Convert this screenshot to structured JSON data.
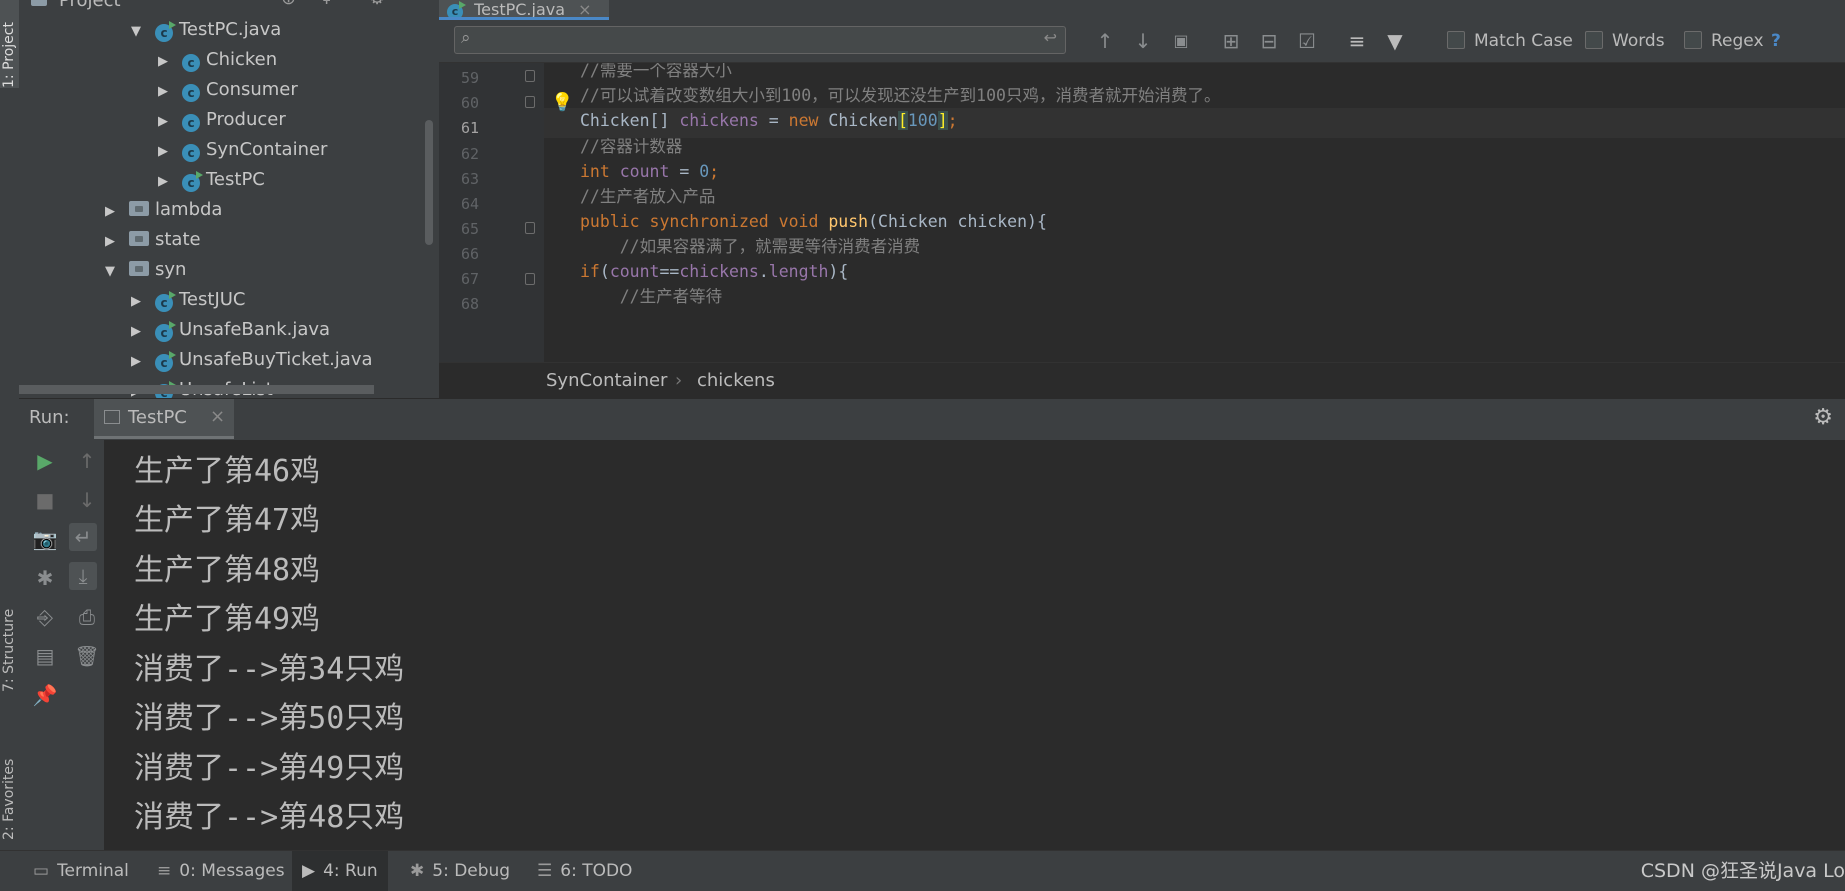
{
  "left_strip": {
    "project_tab": "1: Project",
    "structure_tab": "7: Structure",
    "favorites_tab": "2: Favorites"
  },
  "project_panel": {
    "title": "Project",
    "tree": [
      {
        "label": "TestPC.java",
        "icon": "run-class-icon",
        "expanded": true
      },
      {
        "label": "Chicken",
        "icon": "class-icon",
        "expanded": false
      },
      {
        "label": "Consumer",
        "icon": "class-icon",
        "expanded": false
      },
      {
        "label": "Producer",
        "icon": "class-icon",
        "expanded": false
      },
      {
        "label": "SynContainer",
        "icon": "class-icon",
        "expanded": false
      },
      {
        "label": "TestPC",
        "icon": "run-class-icon",
        "expanded": false
      },
      {
        "label": "lambda",
        "icon": "package-icon",
        "expanded": false
      },
      {
        "label": "state",
        "icon": "package-icon",
        "expanded": false
      },
      {
        "label": "syn",
        "icon": "package-icon",
        "expanded": true
      },
      {
        "label": "TestJUC",
        "icon": "run-class-icon",
        "expanded": false
      },
      {
        "label": "UnsafeBank.java",
        "icon": "run-class-icon",
        "expanded": false
      },
      {
        "label": "UnsafeBuyTicket.java",
        "icon": "run-class-icon",
        "expanded": false
      },
      {
        "label": "UnsafeList",
        "icon": "run-class-icon",
        "expanded": false
      }
    ]
  },
  "editor": {
    "tab_label": "TestPC.java",
    "search": {
      "value": "",
      "match_case": "Match Case",
      "words": "Words",
      "regex": "Regex",
      "help": "?"
    },
    "lines": [
      {
        "num": "59",
        "text": "//需要一个容器大小"
      },
      {
        "num": "60",
        "text": "//可以试着改变数组大小到100，可以发现还没生产到100只鸡，消费者就开始消费了。"
      },
      {
        "num": "61",
        "text": "Chicken[] chickens = new Chicken[100];"
      },
      {
        "num": "62",
        "text": "//容器计数器"
      },
      {
        "num": "63",
        "text": "int count = 0;"
      },
      {
        "num": "64",
        "text": "//生产者放入产品"
      },
      {
        "num": "65",
        "text": "public synchronized void push(Chicken chicken){"
      },
      {
        "num": "66",
        "text": "    //如果容器满了，就需要等待消费者消费"
      },
      {
        "num": "67",
        "text": "if(count==chickens.length){"
      },
      {
        "num": "68",
        "text": "    //生产者等待"
      }
    ],
    "current_line": "61",
    "breadcrumb": [
      "SynContainer",
      "chickens"
    ]
  },
  "run_panel": {
    "label": "Run:",
    "tab": "TestPC",
    "output": [
      "生产了第46鸡",
      "生产了第47鸡",
      "生产了第48鸡",
      "生产了第49鸡",
      "消费了-->第34只鸡",
      "消费了-->第50只鸡",
      "消费了-->第49只鸡",
      "消费了-->第48只鸡"
    ]
  },
  "bottom_bar": {
    "terminal": "Terminal",
    "messages": "0: Messages",
    "run": "4: Run",
    "debug": "5: Debug",
    "todo": "6: TODO",
    "watermark": "CSDN @狂圣说Java Lo"
  },
  "colors": {
    "background": "#2b2b2b",
    "panel": "#3c3f41",
    "keyword": "#cc7832",
    "comment": "#808080",
    "field": "#9876aa",
    "number": "#6897bb",
    "method": "#ffc66d",
    "run_green": "#59a869",
    "class_blue": "#3a8fb8"
  }
}
